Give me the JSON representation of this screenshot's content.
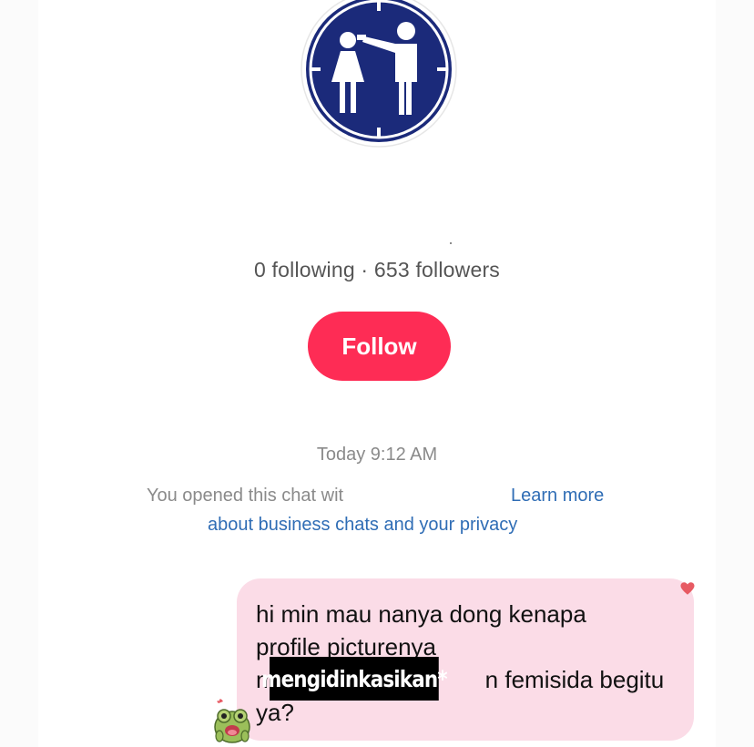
{
  "profile": {
    "avatar_icon": "femicide-pictogram-icon",
    "following_count": "0",
    "followers_count": "653",
    "stats_text": "0 following · 653 followers",
    "follow_label": "Follow"
  },
  "chat": {
    "timestamp": "Today 9:12 AM",
    "notice_prefix": "You opened this chat wit",
    "notice_link_line1": "Learn more",
    "notice_link_line2": "about business chats and your privacy",
    "message": {
      "lines": [
        "hi min mau nanya dong kenapa",
        "profile picturenya",
        "m",
        "n femisida begitu",
        "ya?"
      ],
      "sticker_text": "mengidinkasikan*"
    },
    "icons": {
      "heart": "heart-icon",
      "sender_avatar": "frog-sticker-avatar"
    }
  },
  "colors": {
    "follow_button": "#fe2c55",
    "bubble": "#fbdce7",
    "link": "#2f6db5",
    "avatar_navy": "#1b2a7a"
  }
}
